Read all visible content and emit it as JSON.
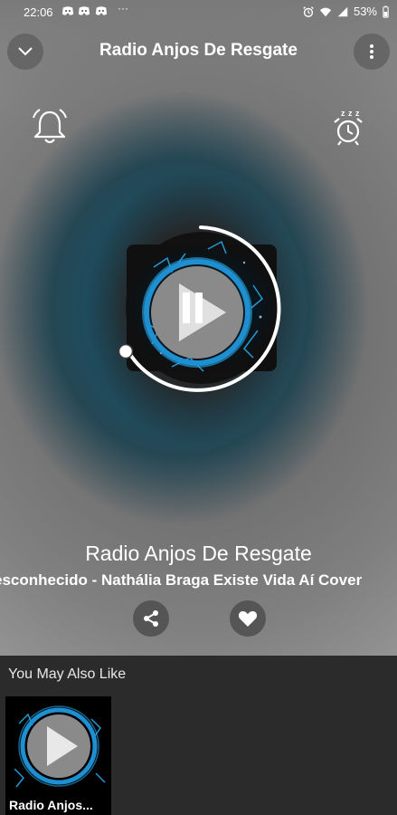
{
  "status_bar": {
    "time": "22:06",
    "app_icons": [
      "discord-icon",
      "discord-icon",
      "discord-icon"
    ],
    "more": "···",
    "battery": "53%"
  },
  "header": {
    "title": "Radio Anjos De Resgate"
  },
  "player": {
    "station_name": "Radio Anjos De Resgate",
    "track_info": "esconhecido - Nathália Braga Existe Vida Aí Cover",
    "state": "playing"
  },
  "recommendations": {
    "title": "You May Also Like",
    "items": [
      {
        "label": "Radio Anjos..."
      }
    ]
  },
  "colors": {
    "accent_blue": "#2aa8e8",
    "ring_white": "#ffffff",
    "bottom_bg": "#2b2b2b"
  }
}
